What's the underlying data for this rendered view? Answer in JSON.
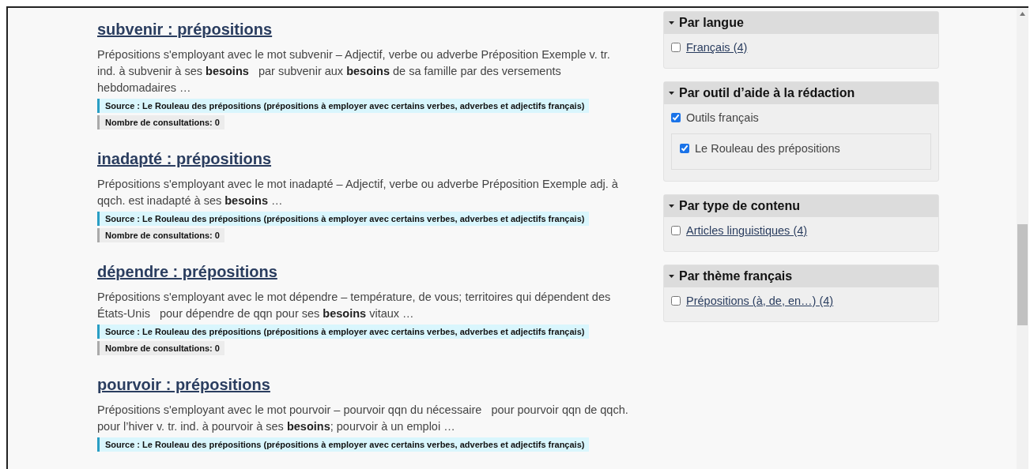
{
  "results": [
    {
      "title": "subvenir : prépositions",
      "description": "Prépositions s'employant avec le mot subvenir – Adjectif, verbe ou adverbe Préposition Exemple v. tr. ind. à subvenir à ses **besoins**   par subvenir aux **besoins** de sa famille par des versements hebdomadaires …",
      "source": "Source : Le Rouleau des prépositions (prépositions à employer avec certains verbes, adverbes et adjectifs français)",
      "views": "Nombre de consultations: 0"
    },
    {
      "title": "inadapté : prépositions",
      "description": "Prépositions s'employant avec le mot inadapté – Adjectif, verbe ou adverbe Préposition Exemple adj. à qqch. est inadapté à ses **besoins** …",
      "source": "Source : Le Rouleau des prépositions (prépositions à employer avec certains verbes, adverbes et adjectifs français)",
      "views": "Nombre de consultations: 0"
    },
    {
      "title": "dépendre : prépositions",
      "description": "Prépositions s'employant avec le mot dépendre – température, de vous; territoires qui dépendent des États-Unis   pour dépendre de qqn pour ses **besoins** vitaux …",
      "source": "Source : Le Rouleau des prépositions (prépositions à employer avec certains verbes, adverbes et adjectifs français)",
      "views": "Nombre de consultations: 0"
    },
    {
      "title": "pourvoir : prépositions",
      "description": "Prépositions s'employant avec le mot pourvoir – pourvoir qqn du nécessaire   pour pourvoir qqn de qqch. pour l’hiver v. tr. ind. à pourvoir à ses **besoins**; pourvoir à un emploi …",
      "source": "Source : Le Rouleau des prépositions (prépositions à employer avec certains verbes, adverbes et adjectifs français)"
    }
  ],
  "facets": [
    {
      "title": "Par langue",
      "expanded": true,
      "options": [
        {
          "label": "Français (4)",
          "kind": "link",
          "checked": false
        }
      ]
    },
    {
      "title": "Par outil d’aide à la rédaction",
      "expanded": true,
      "options": [
        {
          "label": "Outils français",
          "kind": "plain",
          "checked": true,
          "children": [
            {
              "label": "Le Rouleau des prépositions",
              "kind": "plain",
              "checked": true
            }
          ]
        }
      ]
    },
    {
      "title": "Par type de contenu",
      "expanded": true,
      "options": [
        {
          "label": "Articles linguistiques (4)",
          "kind": "link",
          "checked": false
        }
      ]
    },
    {
      "title": "Par thème français",
      "expanded": true,
      "options": [
        {
          "label": "Prépositions (à, de, en…) (4)",
          "kind": "link",
          "checked": false
        }
      ]
    }
  ]
}
